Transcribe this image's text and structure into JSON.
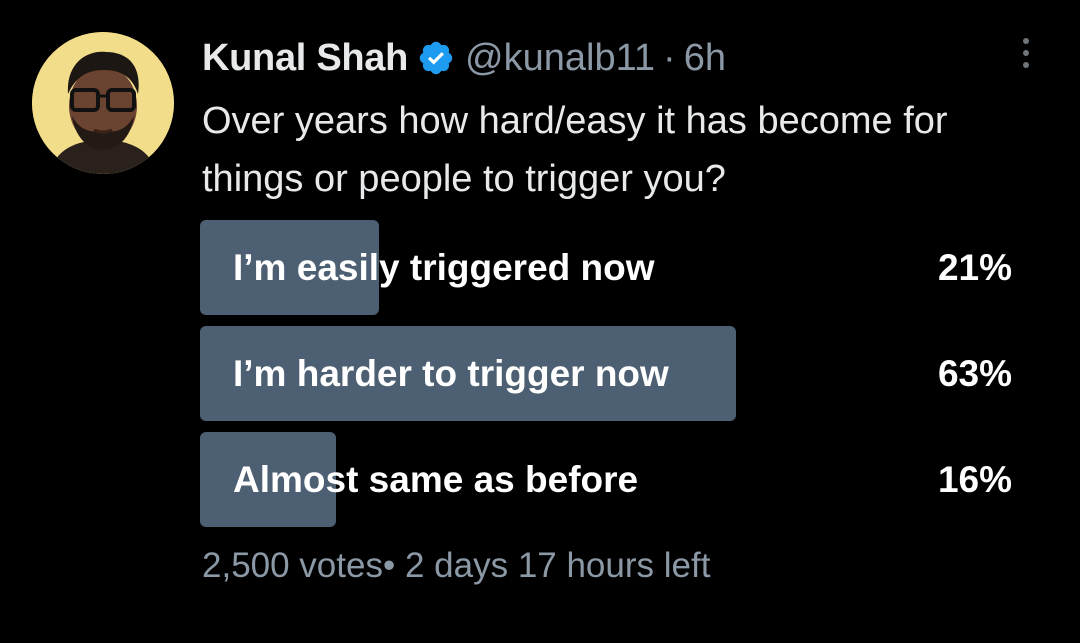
{
  "author": {
    "name": "Kunal Shah",
    "handle": "@kunalb11",
    "separator": "·",
    "time": "6h"
  },
  "tweet": {
    "text": "Over years how hard/easy it has become for things or people to trigger you?"
  },
  "poll": {
    "options": [
      {
        "label": "I’m easily triggered now",
        "percent": "21%",
        "fraction": 0.21
      },
      {
        "label": "I’m harder to trigger now",
        "percent": "63%",
        "fraction": 0.63
      },
      {
        "label": "Almost same as before",
        "percent": "16%",
        "fraction": 0.16
      }
    ],
    "votes": "2,500 votes",
    "separator": "•",
    "time_left": "2 days 17 hours left"
  },
  "icons": {
    "verified": "verified-badge-icon",
    "more": "more-options-icon"
  },
  "colors": {
    "background": "#000000",
    "bar": "#4d5f72",
    "verified": "#1d9bf0",
    "secondary_text": "#8b98a5"
  }
}
